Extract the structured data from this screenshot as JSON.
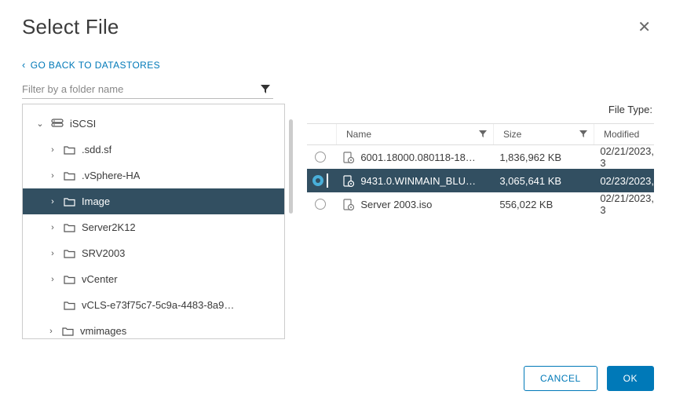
{
  "title": "Select File",
  "go_back": "GO BACK TO DATASTORES",
  "filter_placeholder": "Filter by a folder name",
  "file_type_label": "File Type:",
  "tree": {
    "root": {
      "label": "iSCSI"
    },
    "children": [
      {
        "label": ".sdd.sf"
      },
      {
        "label": ".vSphere-HA"
      },
      {
        "label": "Image"
      },
      {
        "label": "Server2K12"
      },
      {
        "label": "SRV2003"
      },
      {
        "label": "vCenter"
      },
      {
        "label": "vCLS-e73f75c7-5c9a-4483-8a9…"
      }
    ],
    "sibling": {
      "label": "vmimages"
    }
  },
  "columns": {
    "name": "Name",
    "size": "Size",
    "modified": "Modified"
  },
  "files": [
    {
      "name": "6001.18000.080118-18…",
      "size": "1,836,962 KB",
      "modified": "02/21/2023, 3"
    },
    {
      "name": "9431.0.WINMAIN_BLU…",
      "size": "3,065,641 KB",
      "modified": "02/23/2023,"
    },
    {
      "name": "Server 2003.iso",
      "size": "556,022 KB",
      "modified": "02/21/2023, 3"
    }
  ],
  "buttons": {
    "cancel": "CANCEL",
    "ok": "OK"
  }
}
